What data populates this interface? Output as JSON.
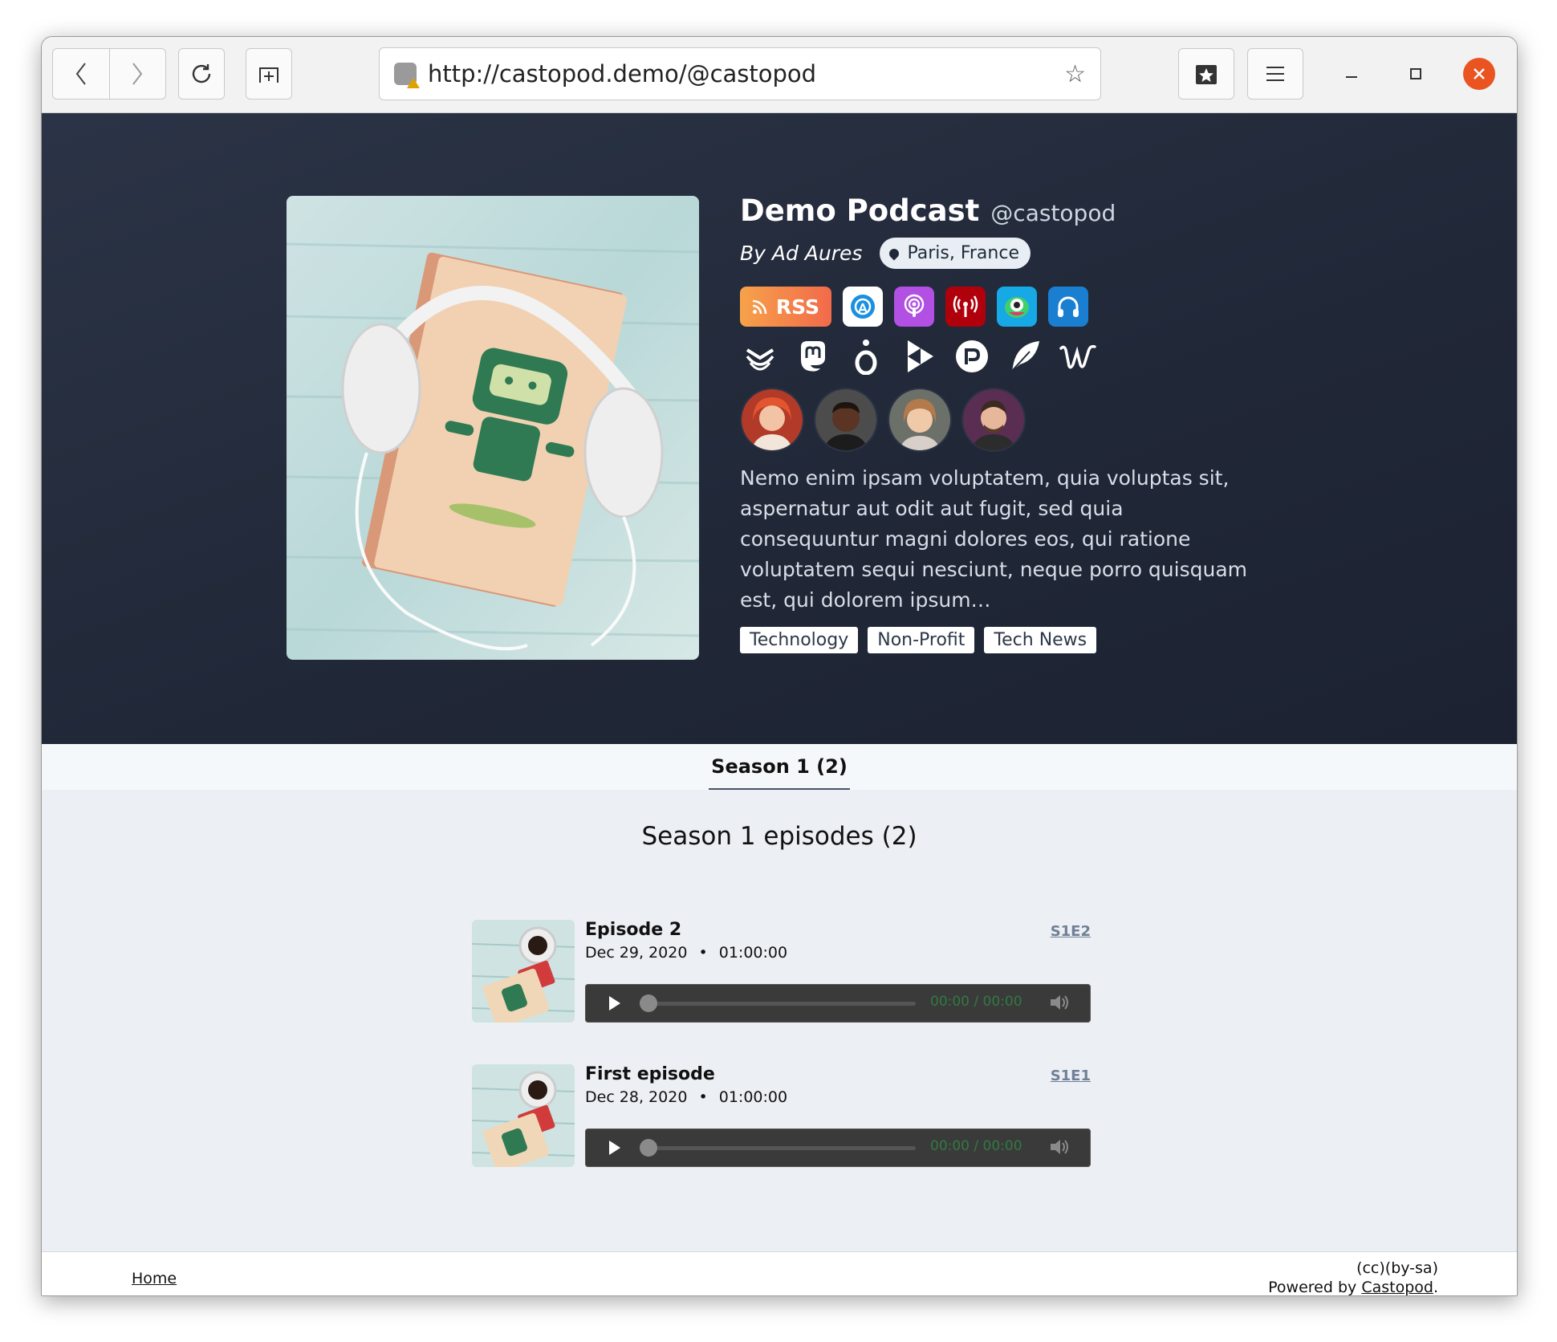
{
  "browser": {
    "url": "http://castopod.demo/@castopod",
    "back_icon": "chevron-left-icon",
    "forward_icon": "chevron-right-icon",
    "reload_icon": "reload-icon",
    "new_tab_icon": "new-tab-icon"
  },
  "podcast": {
    "title": "Demo Podcast",
    "handle": "@castopod",
    "byline": "By Ad Aures",
    "location": "Paris, France",
    "rss_label": "RSS",
    "description": "Nemo enim ipsam voluptatem, quia voluptas sit, aspernatur aut odit aut fugit, sed quia consequuntur magni dolores eos, qui ratione voluptatem sequi nesciunt, neque porro quisquam est, qui dolorem ipsum…",
    "categories": [
      "Technology",
      "Non-Profit",
      "Tech News"
    ],
    "platform_colors": {
      "google": "#ffffff",
      "apple": "#b150e2",
      "pocketcasts": "#b0000b",
      "podcastaddict": "#17a8e6",
      "podcastindex": "#1a7fd0"
    }
  },
  "tabs": [
    {
      "label": "Season 1 (2)"
    }
  ],
  "season": {
    "heading": "Season 1 episodes (2)"
  },
  "episodes": [
    {
      "title": "Episode 2",
      "date": "Dec 29, 2020",
      "duration": "01:00:00",
      "number": "S1E2",
      "time": "00:00 / 00:00"
    },
    {
      "title": "First episode",
      "date": "Dec 28, 2020",
      "duration": "01:00:00",
      "number": "S1E1",
      "time": "00:00 / 00:00"
    }
  ],
  "meta_separator": "•",
  "footer": {
    "home": "Home",
    "license": "(cc)(by-sa)",
    "powered_prefix": "Powered by ",
    "powered_link": "Castopod",
    "powered_suffix": "."
  }
}
